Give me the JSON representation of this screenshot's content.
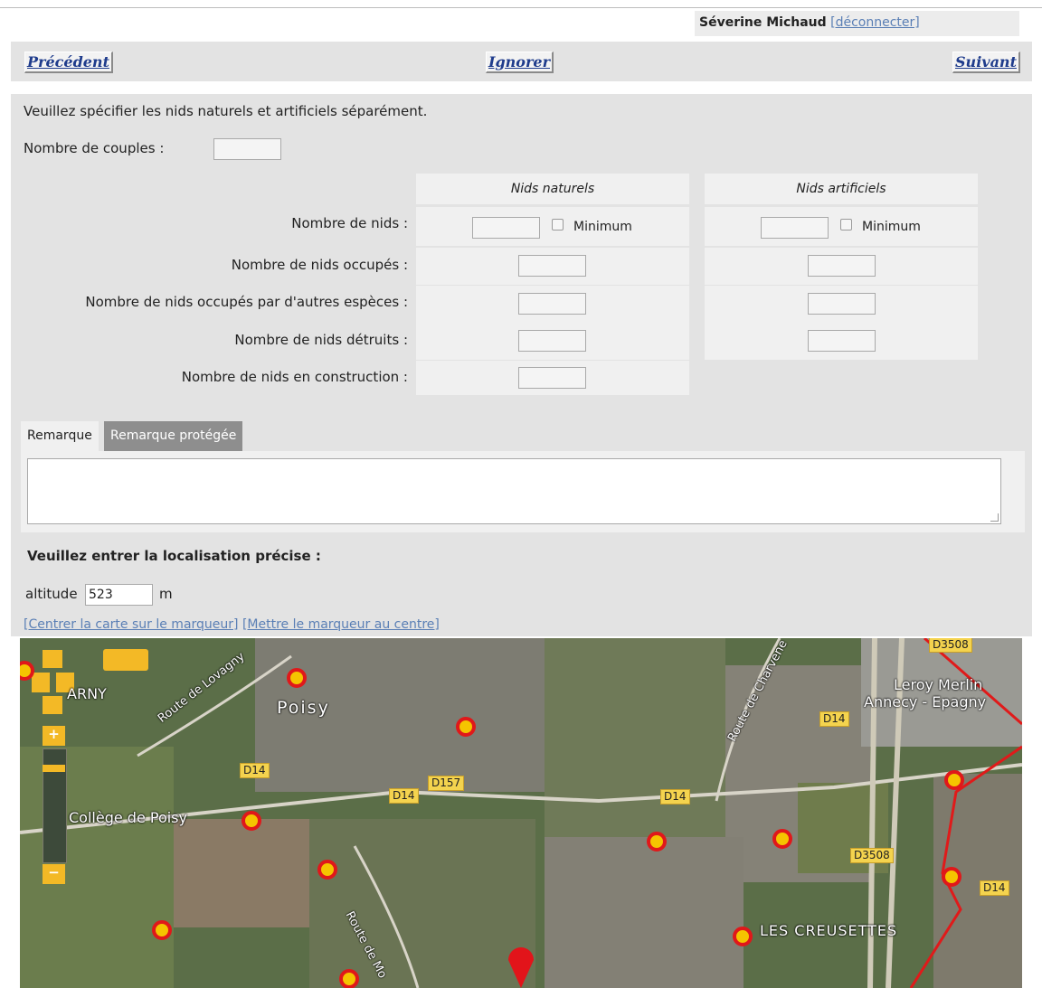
{
  "user": {
    "name": "Séverine Michaud",
    "logout_label": "[déconnecter]"
  },
  "nav": {
    "previous": "Précédent",
    "ignore": "Ignorer",
    "next": "Suivant"
  },
  "form": {
    "instruction": "Veuillez spécifier les nids naturels et artificiels séparément.",
    "couples_label": "Nombre de couples :",
    "columns": {
      "natural": "Nids naturels",
      "artificial": "Nids artificiels"
    },
    "rows": {
      "nests": "Nombre de nids :",
      "occupied": "Nombre de nids occupés :",
      "other_species": "Nombre de nids occupés par d'autres espèces :",
      "destroyed": "Nombre de nids détruits :",
      "construction": "Nombre de nids en construction :"
    },
    "minimum_label": "Minimum"
  },
  "remark": {
    "tab_remark": "Remarque",
    "tab_protected": "Remarque protégée"
  },
  "location": {
    "heading": "Veuillez entrer la localisation précise :",
    "altitude_label": "altitude",
    "altitude_value": "523",
    "altitude_unit": "m",
    "center_map_link": "[Centrer la carte sur le marqueur]",
    "marker_center_link": "[Mettre le marqueur au centre]"
  },
  "map": {
    "places": {
      "arny": "ARNY",
      "poisy": "Poisy",
      "college": "Collège de Poisy",
      "leroy": "Leroy Merlin",
      "leroy2": "Annecy - Epagny",
      "creusettes": "LES CREUSETTES"
    },
    "roads": {
      "lovagny": "Route de Lovagny",
      "charvene": "Route de Charvene",
      "route_mo": "Route de Mo",
      "d14": "D14",
      "d157": "D157",
      "d3508": "D3508"
    }
  }
}
